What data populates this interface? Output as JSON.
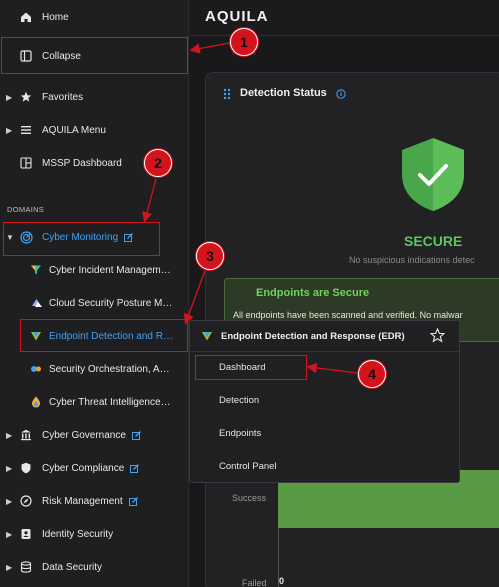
{
  "app": {
    "logo": "AQUILA"
  },
  "sidebar": {
    "home": "Home",
    "collapse": "Collapse",
    "favorites": "Favorites",
    "aquila_menu": "AQUILA Menu",
    "mssp_dashboard": "MSSP Dashboard",
    "domains_label": "DOMAINS",
    "cyber_monitoring": "Cyber Monitoring",
    "sub_items": [
      "Cyber Incident Managem…",
      "Cloud Security Posture M…",
      "Endpoint Detection and R…",
      "Security Orchestration, A…",
      "Cyber Threat Intelligence…"
    ],
    "cyber_governance": "Cyber Governance",
    "cyber_compliance": "Cyber Compliance",
    "risk_management": "Risk Management",
    "identity_security": "Identity Security",
    "data_security": "Data Security"
  },
  "main": {
    "card_title": "Detection Status",
    "status": "SECURE",
    "status_sub": "No suspicious indications detec",
    "banner_title": "Endpoints are Secure",
    "banner_text": "All endpoints have been scanned and verified. No malwar",
    "chart_success": "Success",
    "chart_failed": "Failed",
    "chart_zero": "0"
  },
  "flyout": {
    "title": "Endpoint Detection and Response (EDR)",
    "items": [
      "Dashboard",
      "Detection",
      "Endpoints",
      "Control Panel"
    ]
  },
  "annotations": {
    "b1": "1",
    "b2": "2",
    "b3": "3",
    "b4": "4"
  },
  "colors": {
    "accent": "#3fa2f5",
    "secure": "#5cc65a",
    "annotation": "#d3141c"
  }
}
